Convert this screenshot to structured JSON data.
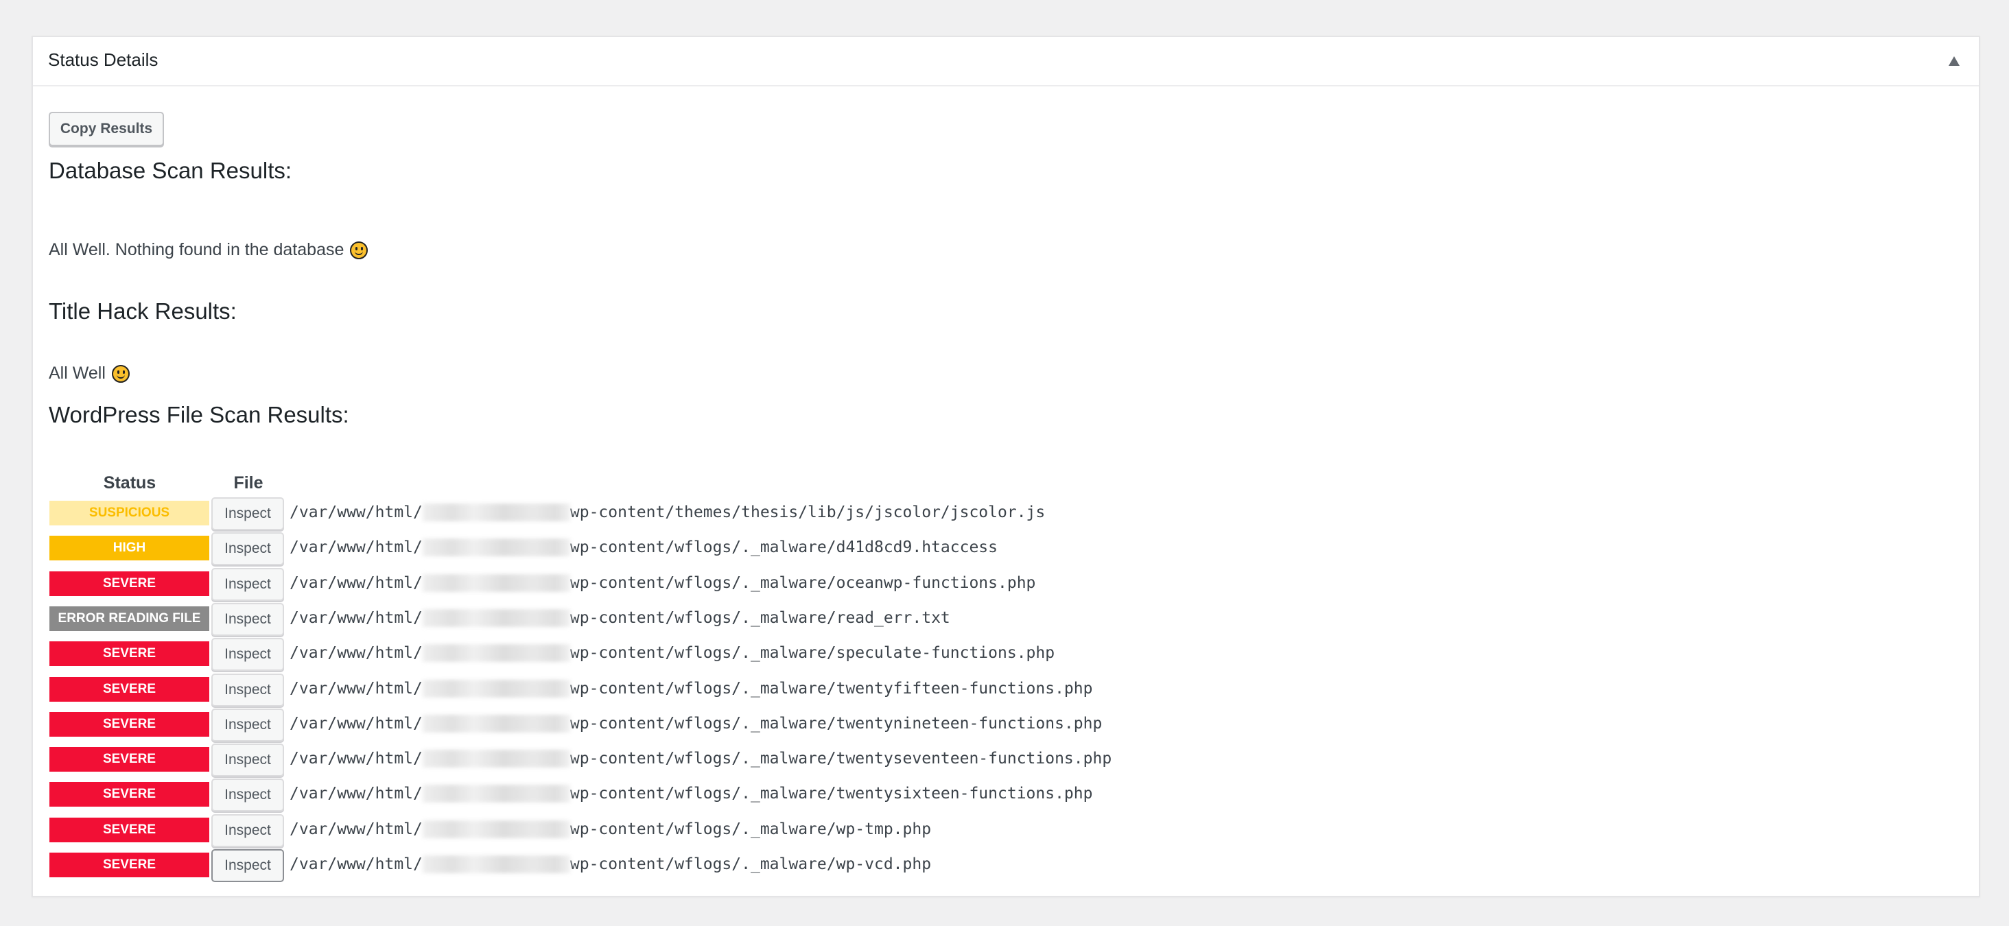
{
  "panel": {
    "title": "Status Details",
    "toggle_icon": "triangle-up-icon"
  },
  "toolbar": {
    "copy_label": "Copy Results"
  },
  "database_scan": {
    "heading": "Database Scan Results:",
    "message": "All Well. Nothing found in the database",
    "icon": "smiley-icon"
  },
  "title_hack": {
    "heading": "Title Hack Results:",
    "message": "All Well",
    "icon": "smiley-icon"
  },
  "file_scan": {
    "heading": "WordPress File Scan Results:",
    "columns": [
      "Status",
      "File"
    ],
    "inspect_label": "Inspect",
    "path_prefix": "/var/www/html/",
    "status_colors": {
      "SUSPICIOUS": {
        "bg": "#ffeba5",
        "fg": "#fbbd00"
      },
      "HIGH": {
        "bg": "#fbbd00",
        "fg": "#ffffff"
      },
      "SEVERE": {
        "bg": "#f20f35",
        "fg": "#ffffff"
      },
      "ERROR READING FILE": {
        "bg": "#8a8a8a",
        "fg": "#ffffff"
      }
    },
    "rows": [
      {
        "status": "SUSPICIOUS",
        "path": "wp-content/themes/thesis/lib/js/jscolor/jscolor.js"
      },
      {
        "status": "HIGH",
        "path": "wp-content/wflogs/._malware/d41d8cd9.htaccess"
      },
      {
        "status": "SEVERE",
        "path": "wp-content/wflogs/._malware/oceanwp-functions.php"
      },
      {
        "status": "ERROR READING FILE",
        "path": "wp-content/wflogs/._malware/read_err.txt"
      },
      {
        "status": "SEVERE",
        "path": "wp-content/wflogs/._malware/speculate-functions.php"
      },
      {
        "status": "SEVERE",
        "path": "wp-content/wflogs/._malware/twentyfifteen-functions.php"
      },
      {
        "status": "SEVERE",
        "path": "wp-content/wflogs/._malware/twentynineteen-functions.php"
      },
      {
        "status": "SEVERE",
        "path": "wp-content/wflogs/._malware/twentyseventeen-functions.php"
      },
      {
        "status": "SEVERE",
        "path": "wp-content/wflogs/._malware/twentysixteen-functions.php"
      },
      {
        "status": "SEVERE",
        "path": "wp-content/wflogs/._malware/wp-tmp.php"
      },
      {
        "status": "SEVERE",
        "path": "wp-content/wflogs/._malware/wp-vcd.php"
      }
    ]
  }
}
